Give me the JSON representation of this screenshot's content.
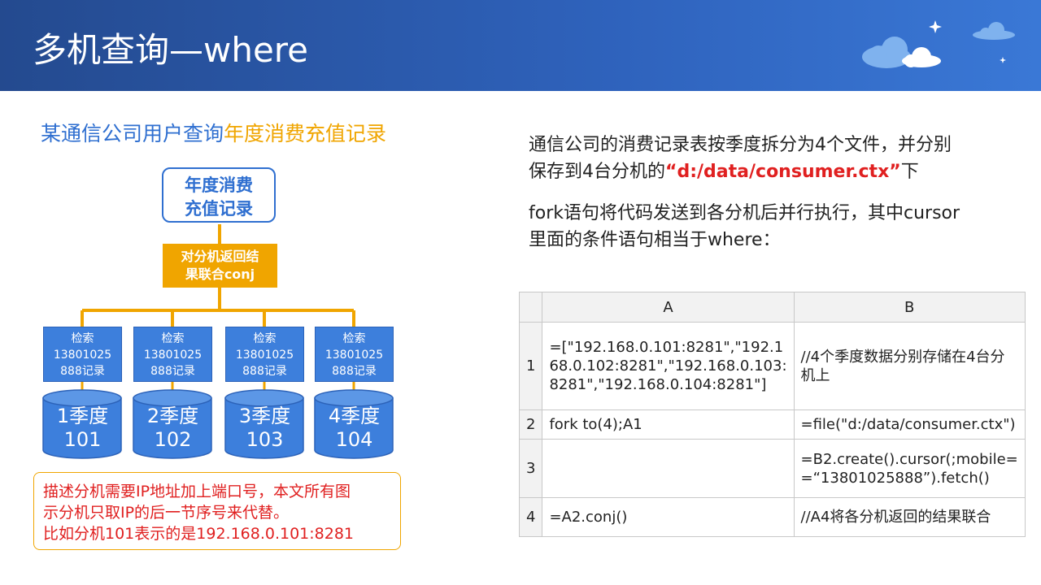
{
  "header": {
    "title": "多机查询—where"
  },
  "subtitle": {
    "part1": "某通信公司用户查询",
    "part2": "年度消费充值记录"
  },
  "diagram": {
    "top_box": [
      "年度消费",
      "充值记录"
    ],
    "merge_box": [
      "对分机返回结",
      "果联合conj"
    ],
    "search_boxes": [
      [
        "检索",
        "13801025",
        "888记录"
      ],
      [
        "检索",
        "13801025",
        "888记录"
      ],
      [
        "检索",
        "13801025",
        "888记录"
      ],
      [
        "检索",
        "13801025",
        "888记录"
      ]
    ],
    "cylinders": [
      [
        "1季度",
        "101"
      ],
      [
        "2季度",
        "102"
      ],
      [
        "3季度",
        "103"
      ],
      [
        "4季度",
        "104"
      ]
    ]
  },
  "note": [
    "描述分机需要IP地址加上端口号，本文所有图",
    "示分机只取IP的后一节序号来代替。",
    "比如分机101表示的是192.168.0.101:8281"
  ],
  "para1": {
    "line1": "通信公司的消费记录表按季度拆分为4个文件，并分别",
    "line2_pre": "保存到4台分机的",
    "line2_red": "“d:/data/consumer.ctx”",
    "line2_post": "下"
  },
  "para2": {
    "line1": "fork语句将代码发送到各分机后并行执行，其中cursor",
    "line2": "里面的条件语句相当于where："
  },
  "table": {
    "col_headers": [
      "A",
      "B"
    ],
    "rows": [
      {
        "idx": "1",
        "a": [
          "=[\"192.168.0.101:8281\",\"192.1",
          "68.0.102:8281\",\"192.168.0.103:",
          "8281\",\"192.168.0.104:8281\"]"
        ],
        "b": [
          "//4个季度数据分别存储在4台分",
          "机上"
        ]
      },
      {
        "idx": "2",
        "a": [
          "fork to(4);A1"
        ],
        "b": [
          "=file(\"d:/data/consumer.ctx\")"
        ]
      },
      {
        "idx": "3",
        "a": [
          ""
        ],
        "b": [
          "=B2.create().cursor(;mobile=",
          "=“13801025888”).fetch()"
        ]
      },
      {
        "idx": "4",
        "a": [
          "=A2.conj()"
        ],
        "b": [
          "//A4将各分机返回的结果联合"
        ]
      }
    ]
  },
  "colors": {
    "header_blue": "#2f63bd",
    "accent_blue": "#2f6fd0",
    "accent_orange": "#f0a500",
    "red": "#e02020"
  }
}
